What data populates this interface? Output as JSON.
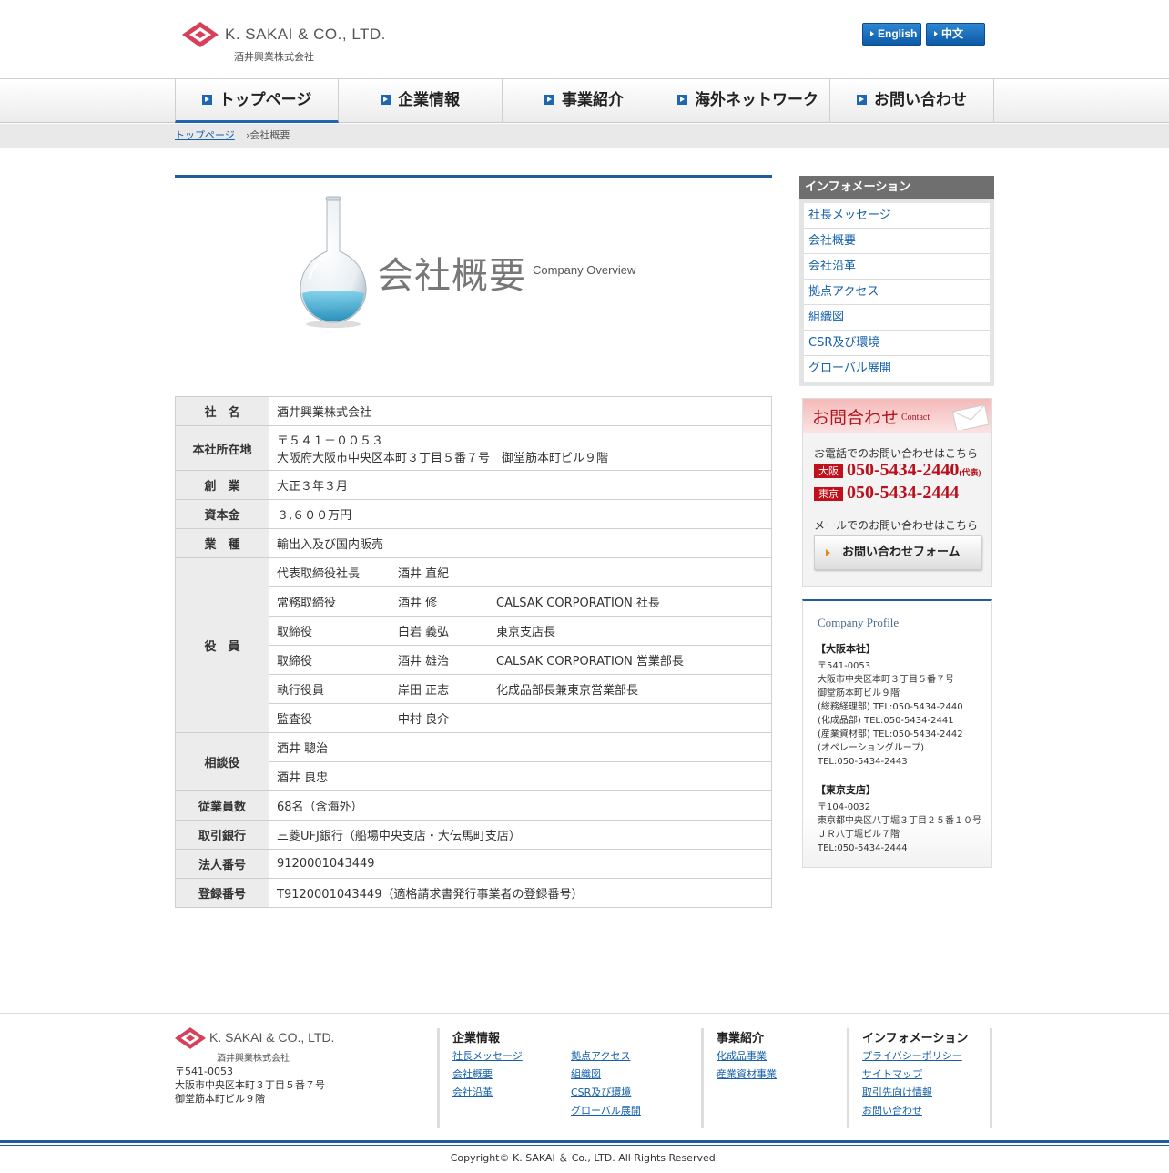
{
  "header": {
    "logo_name": "K. SAKAI & CO., LTD.",
    "logo_sub": "酒井興業株式会社",
    "lang_english": "English",
    "lang_chinese": "中文"
  },
  "nav": {
    "items": [
      "トップページ",
      "企業情報",
      "事業紹介",
      "海外ネットワーク",
      "お問い合わせ"
    ]
  },
  "breadcrumb": {
    "home": "トップページ",
    "current": "›会社概要"
  },
  "overview": {
    "title": "会社概要",
    "subtitle": "Company Overview"
  },
  "table": {
    "name_label": "社　名",
    "name_value": "酒井興業株式会社",
    "address_label": "本社所在地",
    "address_line1": "〒５４１－００５３",
    "address_line2": "大阪府大阪市中央区本町３丁目５番７号　御堂筋本町ビル９階",
    "founded_label": "創　業",
    "founded_value": "大正３年３月",
    "capital_label": "資本金",
    "capital_value": "３,６００万円",
    "business_label": "業　種",
    "business_value": "輸出入及び国内販売",
    "officers_label": "役　員",
    "officers": [
      {
        "title": "代表取締役社長",
        "name": "酒井 直紀",
        "note": ""
      },
      {
        "title": "常務取締役",
        "name": "酒井 修",
        "note": "CALSAK CORPORATION 社長"
      },
      {
        "title": "取締役",
        "name": "白岩 義弘",
        "note": "東京支店長"
      },
      {
        "title": "取締役",
        "name": "酒井 雄治",
        "note": "CALSAK CORPORATION 営業部長"
      },
      {
        "title": "執行役員",
        "name": "岸田 正志",
        "note": "化成品部長兼東京営業部長"
      },
      {
        "title": "監査役",
        "name": "中村 良介",
        "note": ""
      }
    ],
    "advisors_label": "相談役",
    "advisors": [
      "酒井 聰治",
      "酒井 良忠"
    ],
    "employees_label": "従業員数",
    "employees_value": "68名（含海外）",
    "bank_label": "取引銀行",
    "bank_value": "三菱UFJ銀行（船場中央支店・大伝馬町支店）",
    "corpnum_label": "法人番号",
    "corpnum_value": "9120001043449",
    "regnum_label": "登録番号",
    "regnum_value": "T9120001043449（適格請求書発行事業者の登録番号）"
  },
  "sidebar": {
    "info_title": "インフォメーション",
    "info_items": [
      "社長メッセージ",
      "会社概要",
      "会社沿革",
      "拠点アクセス",
      "組織図",
      "CSR及び環境",
      "グローバル展開"
    ],
    "contact_title": "お問合わせ",
    "contact_title_en": "Contact",
    "contact_phone_text": "お電話でのお問い合わせはこちら",
    "osaka_tag": "大阪",
    "osaka_number": "050-5434-2440",
    "osaka_suffix": "(代表)",
    "tokyo_tag": "東京",
    "tokyo_number": "050-5434-2444",
    "contact_mail_text": "メールでのお問い合わせはこちら",
    "contact_form_button": "お問い合わせフォーム",
    "profile_title": "Company Profile",
    "osaka_head": "【大阪本社】",
    "osaka_lines": [
      "〒541-0053",
      "大阪市中央区本町３丁目５番７号",
      "御堂筋本町ビル９階",
      "(総務経理部) TEL:050-5434-2440",
      "(化成品部) TEL:050-5434-2441",
      "(産業資材部) TEL:050-5434-2442",
      "(オペレーショングループ)",
      "TEL:050-5434-2443"
    ],
    "tokyo_head": "【東京支店】",
    "tokyo_lines": [
      "〒104-0032",
      "東京都中央区八丁堀３丁目２５番１０号",
      "ＪＲ八丁堀ビル７階",
      "TEL:050-5434-2444"
    ]
  },
  "footer": {
    "logo_name": "K. SAKAI & CO., LTD.",
    "logo_sub": "酒井興業株式会社",
    "address": [
      "〒541-0053",
      "大阪市中央区本町３丁目５番７号",
      "御堂筋本町ビル９階"
    ],
    "col1_title": "企業情報",
    "col1_links": [
      "社長メッセージ",
      "会社概要",
      "会社沿革",
      "拠点アクセス",
      "組織図",
      "CSR及び環境",
      "グローバル展開"
    ],
    "col2_title": "事業紹介",
    "col2_links": [
      "化成品事業",
      "産業資材事業"
    ],
    "col3_title": "インフォメーション",
    "col3_links": [
      "プライバシーポリシー",
      "サイトマップ",
      "取引先向け情報",
      "お問い合わせ"
    ],
    "copyright": "Copyright© K. SAKAI ＆ Co., LTD. All Rights Reserved."
  },
  "colors": {
    "accent": "#1d5e9b",
    "link": "#1560a8",
    "contact_red": "#b8101c",
    "logo_red": "#d8405a"
  }
}
